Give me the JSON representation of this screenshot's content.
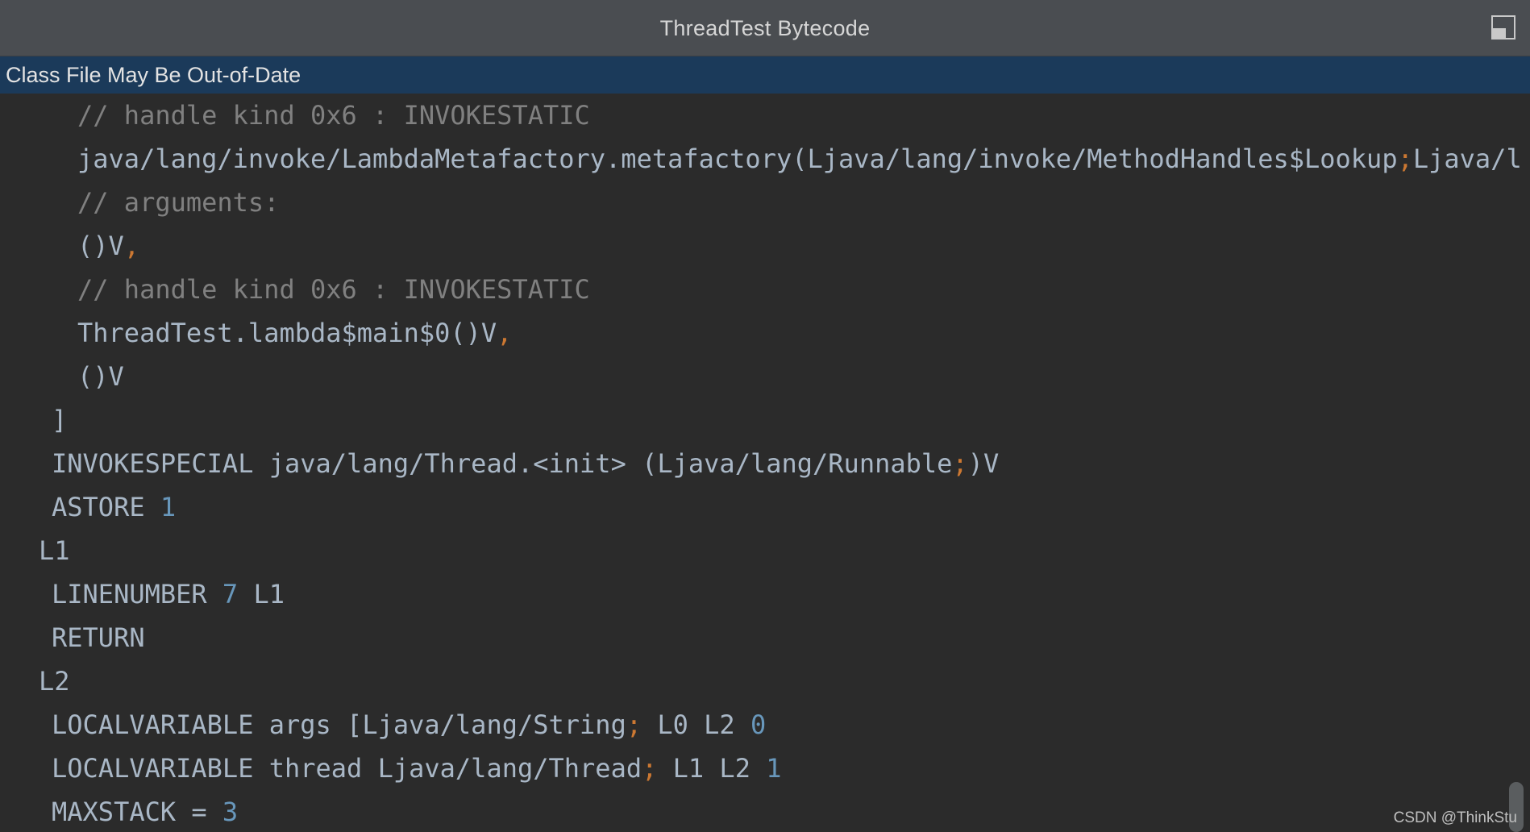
{
  "window": {
    "title": "ThreadTest Bytecode",
    "dock_icon": "restore-window-icon"
  },
  "notice": {
    "text": "Class File May Be Out-of-Date"
  },
  "code": {
    "lines": [
      {
        "indent": 6,
        "tokens": [
          {
            "t": "comment",
            "v": "// handle kind 0x6 : INVOKESTATIC"
          }
        ]
      },
      {
        "indent": 6,
        "tokens": [
          {
            "t": "text",
            "v": "java/lang/invoke/LambdaMetafactory.metafactory(Ljava/lang/invoke/MethodHandles$Lookup"
          },
          {
            "t": "punc",
            "v": ";"
          },
          {
            "t": "text",
            "v": "Ljava/l"
          }
        ]
      },
      {
        "indent": 6,
        "tokens": [
          {
            "t": "comment",
            "v": "// arguments:"
          }
        ]
      },
      {
        "indent": 6,
        "tokens": [
          {
            "t": "text",
            "v": "()V"
          },
          {
            "t": "punc",
            "v": ","
          }
        ]
      },
      {
        "indent": 6,
        "tokens": [
          {
            "t": "comment",
            "v": "// handle kind 0x6 : INVOKESTATIC"
          }
        ]
      },
      {
        "indent": 6,
        "tokens": [
          {
            "t": "text",
            "v": "ThreadTest.lambda$main$0()V"
          },
          {
            "t": "punc",
            "v": ","
          }
        ]
      },
      {
        "indent": 6,
        "tokens": [
          {
            "t": "text",
            "v": "()V"
          }
        ]
      },
      {
        "indent": 4,
        "tokens": [
          {
            "t": "text",
            "v": "]"
          }
        ]
      },
      {
        "indent": 4,
        "tokens": [
          {
            "t": "text",
            "v": "INVOKESPECIAL java/lang/Thread.<init> (Ljava/lang/Runnable"
          },
          {
            "t": "punc",
            "v": ";"
          },
          {
            "t": "text",
            "v": ")V"
          }
        ]
      },
      {
        "indent": 4,
        "tokens": [
          {
            "t": "text",
            "v": "ASTORE "
          },
          {
            "t": "num",
            "v": "1"
          }
        ]
      },
      {
        "indent": 3,
        "tokens": [
          {
            "t": "text",
            "v": "L1"
          }
        ]
      },
      {
        "indent": 4,
        "tokens": [
          {
            "t": "text",
            "v": "LINENUMBER "
          },
          {
            "t": "num",
            "v": "7"
          },
          {
            "t": "text",
            "v": " L1"
          }
        ]
      },
      {
        "indent": 4,
        "tokens": [
          {
            "t": "text",
            "v": "RETURN"
          }
        ]
      },
      {
        "indent": 3,
        "tokens": [
          {
            "t": "text",
            "v": "L2"
          }
        ]
      },
      {
        "indent": 4,
        "tokens": [
          {
            "t": "text",
            "v": "LOCALVARIABLE args [Ljava/lang/String"
          },
          {
            "t": "punc",
            "v": ";"
          },
          {
            "t": "text",
            "v": " L0 L2 "
          },
          {
            "t": "num",
            "v": "0"
          }
        ]
      },
      {
        "indent": 4,
        "tokens": [
          {
            "t": "text",
            "v": "LOCALVARIABLE thread Ljava/lang/Thread"
          },
          {
            "t": "punc",
            "v": ";"
          },
          {
            "t": "text",
            "v": " L1 L2 "
          },
          {
            "t": "num",
            "v": "1"
          }
        ]
      },
      {
        "indent": 4,
        "tokens": [
          {
            "t": "text",
            "v": "MAXSTACK = "
          },
          {
            "t": "num",
            "v": "3"
          }
        ]
      }
    ]
  },
  "watermark": {
    "text": "CSDN @ThinkStu"
  },
  "colors": {
    "background": "#2b2b2b",
    "titlebar": "#4a4d51",
    "notice_bar": "#1b3a5a",
    "code_text": "#a9b7c6",
    "comment": "#808080",
    "number": "#6897bb",
    "punctuation": "#cc7832"
  }
}
